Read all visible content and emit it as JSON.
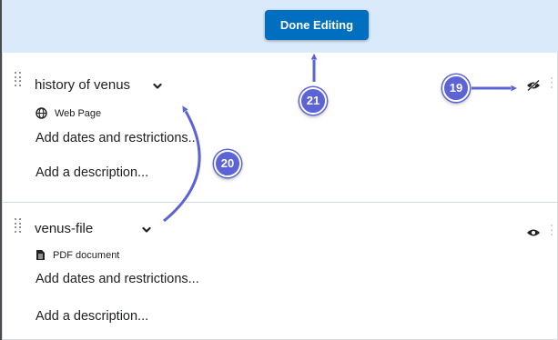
{
  "toolbar": {
    "done_label": "Done Editing"
  },
  "items": [
    {
      "title": "history of venus",
      "type_label": "Web Page",
      "type_icon": "globe-icon",
      "dates_label": "Add dates and restrictions...",
      "description_label": "Add a description...",
      "visibility_icon": "eye-hidden-icon"
    },
    {
      "title": "venus-file",
      "type_label": "PDF document",
      "type_icon": "document-icon",
      "dates_label": "Add dates and restrictions...",
      "description_label": "Add a description...",
      "visibility_icon": "eye-icon"
    }
  ],
  "annotations": {
    "badge_19": "19",
    "badge_20": "20",
    "badge_21": "21",
    "accent_color": "#5b63d6"
  },
  "colors": {
    "topbar_bg": "#dbeafb",
    "button_bg": "#006fbf"
  }
}
